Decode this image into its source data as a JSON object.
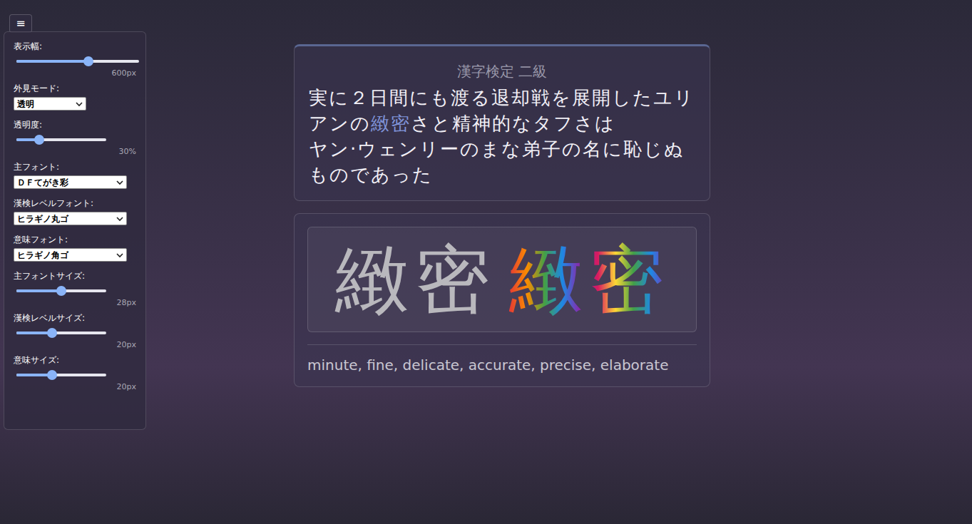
{
  "menu_button": "≡",
  "settings": [
    {
      "kind": "slider",
      "label": "表示幅:",
      "level": 0.59,
      "reading": "600px"
    },
    {
      "kind": "select",
      "label": "外見モード:",
      "value": "透明"
    },
    {
      "kind": "slider",
      "label": "透明度:",
      "level": 0.25,
      "reading": "30%"
    },
    {
      "kind": "select",
      "label": "主フォント:",
      "value": "ＤＦてがき彩"
    },
    {
      "kind": "select",
      "label": "漢検レベルフォント:",
      "value": "ヒラギノ丸ゴ"
    },
    {
      "kind": "select",
      "label": "意味フォント:",
      "value": "ヒラギノ角ゴ"
    },
    {
      "kind": "slider",
      "label": "主フォントサイズ:",
      "level": 0.5,
      "reading": "28px"
    },
    {
      "kind": "slider",
      "label": "漢検レベルサイズ:",
      "level": 0.4,
      "reading": "20px"
    },
    {
      "kind": "slider",
      "label": "意味サイズ:",
      "level": 0.4,
      "reading": "20px"
    }
  ],
  "sentence_card": {
    "level": "漢字検定 二級",
    "segments": [
      {
        "text": "実に２日間にも渡る退却戦を展開したユリアンの",
        "highlight": false
      },
      {
        "text": "緻密",
        "highlight": true
      },
      {
        "text": "さと精神的なタフさは\nヤン·ウェンリーのまな弟子の名に恥じぬものであった",
        "highlight": false
      }
    ]
  },
  "word_card": {
    "word": "緻密",
    "stroke_order": "緻密",
    "meaning": "minute, fine, delicate, accurate, precise, elaborate"
  }
}
